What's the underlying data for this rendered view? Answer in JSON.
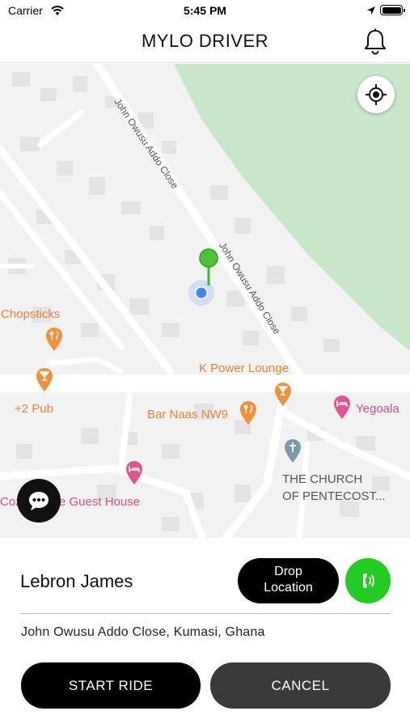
{
  "status_bar": {
    "carrier": "Carrier",
    "time": "5:45 PM",
    "icons": [
      "wifi-icon",
      "location-arrow-icon",
      "battery-icon"
    ]
  },
  "nav": {
    "title": "MYLO DRIVER",
    "right_icon": "bell-icon"
  },
  "map": {
    "road_labels": [
      "John Owusu Addo Close",
      "John Owusu Addo Close"
    ],
    "places": [
      {
        "name": "Chopsticks",
        "type": "restaurant",
        "color": "#e8823a"
      },
      {
        "name": "+2 Pub",
        "type": "bar",
        "color": "#e8823a"
      },
      {
        "name": "K Power Lounge",
        "type": "bar",
        "color": "#e8823a"
      },
      {
        "name": "Bar Naas NW9",
        "type": "restaurant",
        "color": "#e8823a"
      },
      {
        "name": "Yegoala",
        "type": "lodging",
        "color": "#d94b86"
      },
      {
        "name": "Coz",
        "type": "lodging",
        "color": "#d94b86"
      },
      {
        "name": "e Guest House",
        "type": "lodging",
        "color": "#d94b86"
      },
      {
        "name": "THE CHURCH",
        "type": "church",
        "color": "#555555"
      },
      {
        "name": "OF PENTECOST...",
        "type": "church",
        "color": "#555555"
      }
    ],
    "park_color": "#c8e6c9",
    "user_marker_color": "#4285f4",
    "destination_pin_color": "#3cba2e"
  },
  "sheet": {
    "rider_name": "Lebron James",
    "drop_button": {
      "line1": "Drop",
      "line2": "Location"
    },
    "address": "John Owusu Addo Close, Kumasi, Ghana",
    "start_button": "START RIDE",
    "cancel_button": "CANCEL",
    "call_color": "#22cc22"
  }
}
